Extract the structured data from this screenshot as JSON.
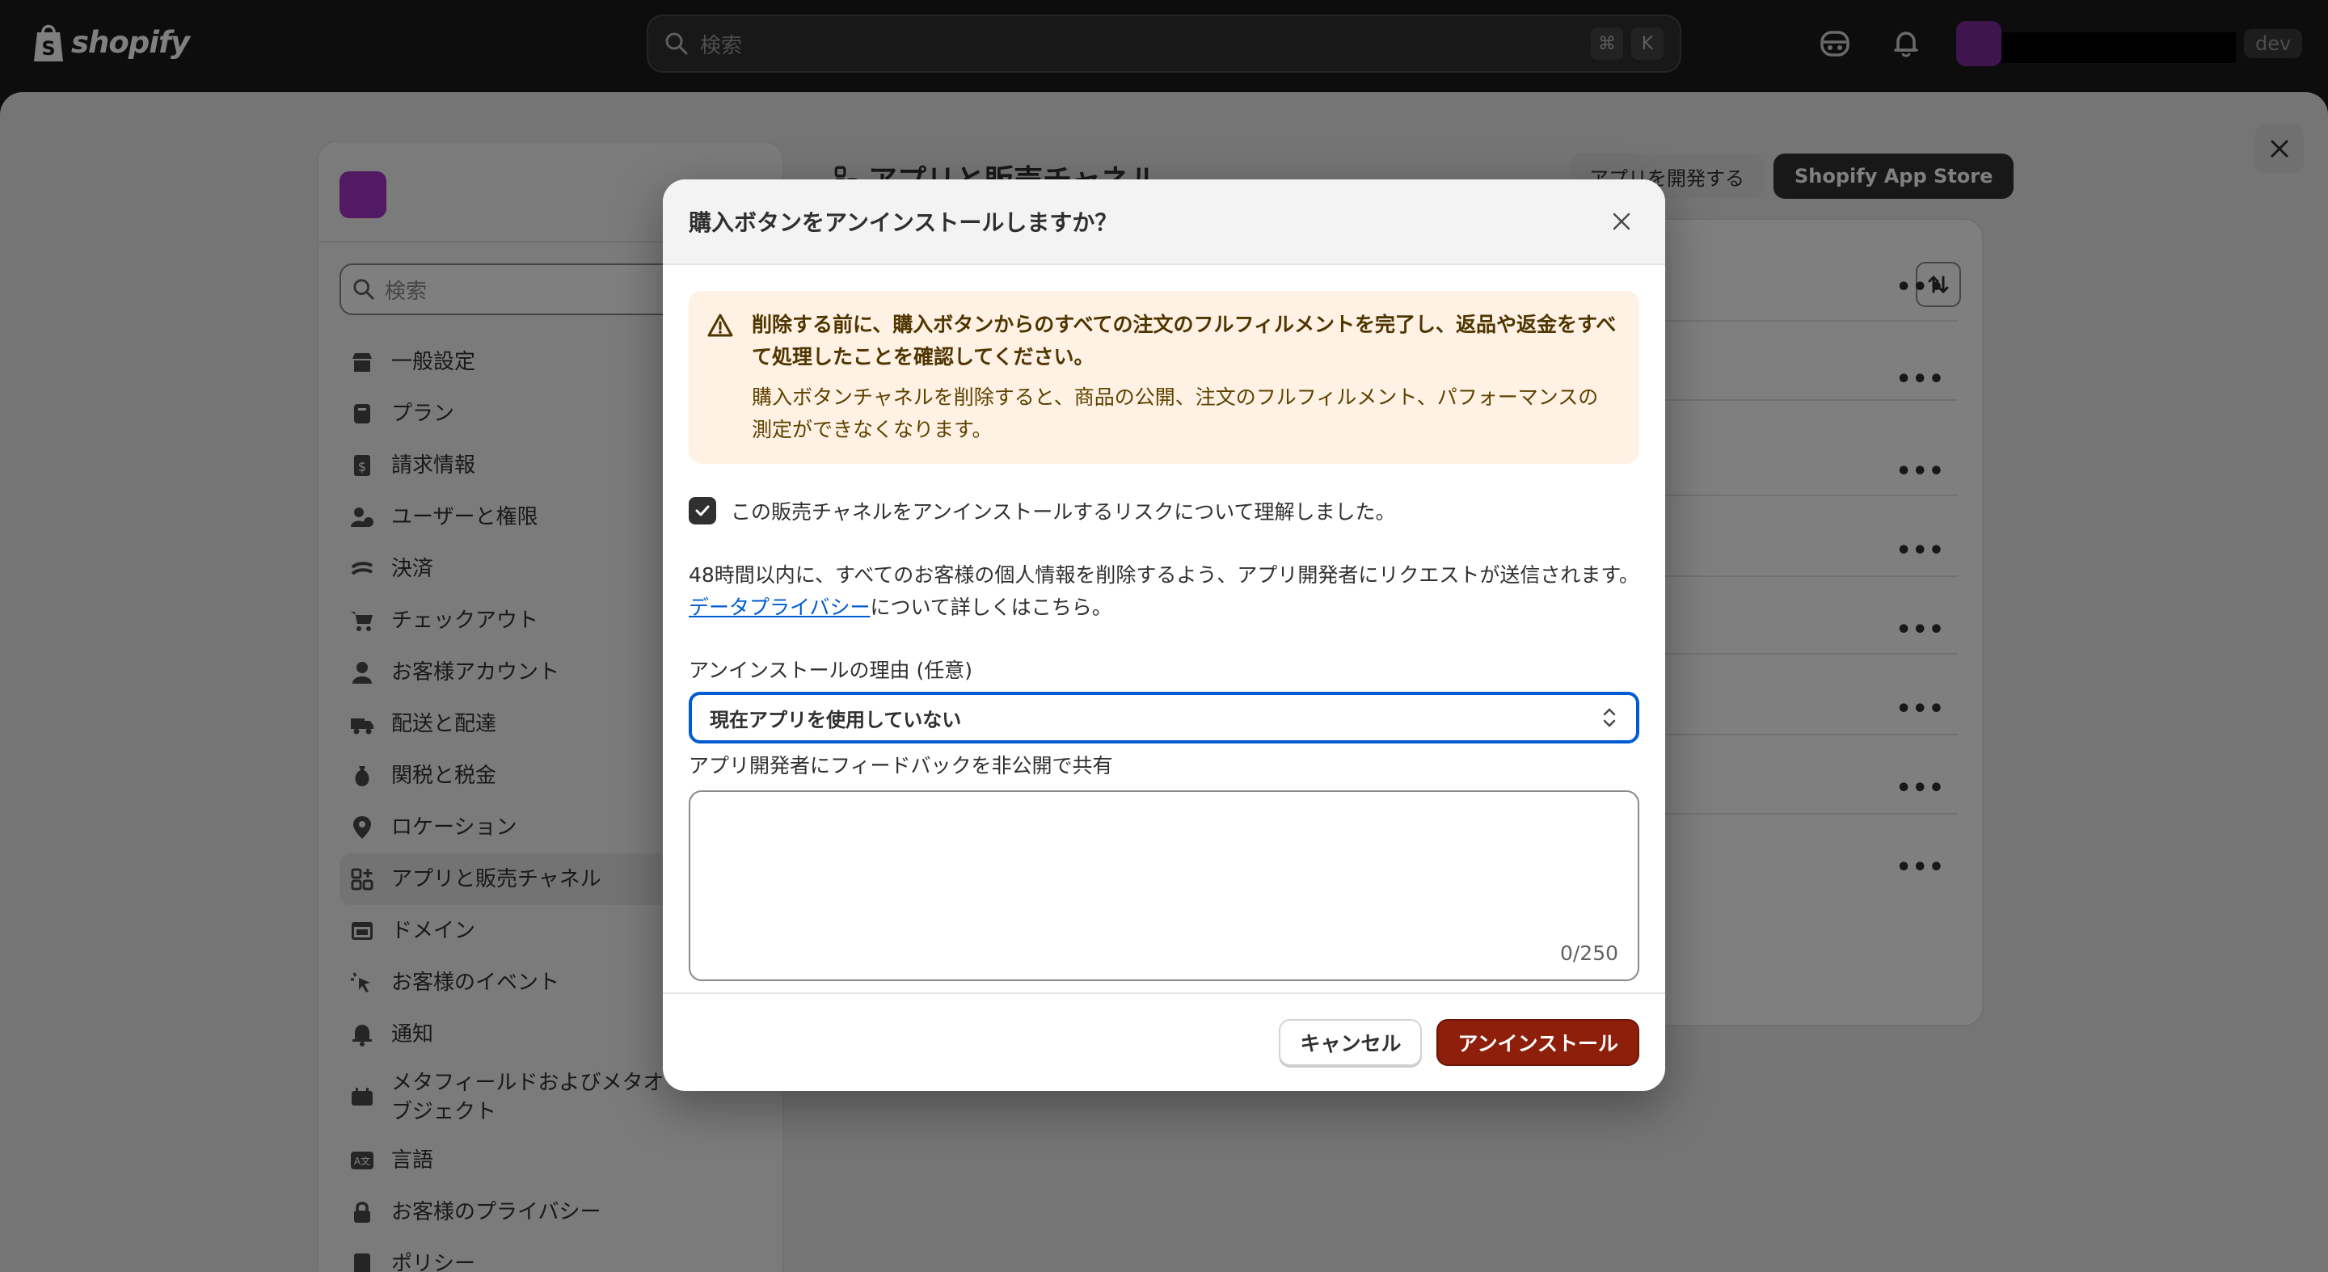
{
  "topbar": {
    "logo_text": "shopify",
    "search_placeholder": "検索",
    "shortcut_keys": [
      "⌘",
      "K"
    ],
    "dev_badge": "dev"
  },
  "settings": {
    "search_placeholder": "検索",
    "sidebar_items": [
      {
        "label": "一般設定",
        "icon": "store-icon"
      },
      {
        "label": "プラン",
        "icon": "plan-icon"
      },
      {
        "label": "請求情報",
        "icon": "billing-icon"
      },
      {
        "label": "ユーザーと権限",
        "icon": "users-icon"
      },
      {
        "label": "決済",
        "icon": "payments-icon"
      },
      {
        "label": "チェックアウト",
        "icon": "cart-icon"
      },
      {
        "label": "お客様アカウント",
        "icon": "person-icon"
      },
      {
        "label": "配送と配達",
        "icon": "truck-icon"
      },
      {
        "label": "関税と税金",
        "icon": "tax-icon"
      },
      {
        "label": "ロケーション",
        "icon": "location-icon"
      },
      {
        "label": "アプリと販売チャネル",
        "icon": "apps-icon"
      },
      {
        "label": "ドメイン",
        "icon": "domain-icon"
      },
      {
        "label": "お客様のイベント",
        "icon": "events-icon"
      },
      {
        "label": "通知",
        "icon": "bell-icon"
      },
      {
        "label": "メタフィールドおよびメタオブジェクト",
        "icon": "metafields-icon"
      },
      {
        "label": "言語",
        "icon": "language-icon"
      },
      {
        "label": "お客様のプライバシー",
        "icon": "lock-icon"
      },
      {
        "label": "ポリシー",
        "icon": "policy-icon"
      }
    ],
    "main_title": "アプリと販売チャネル",
    "btn_develop": "アプリを開発する",
    "btn_store": "Shopify App Store"
  },
  "dialog": {
    "title": "購入ボタンをアンインストールしますか？",
    "banner_title": "削除する前に、購入ボタンからのすべての注文のフルフィルメントを完了し、返品や返金をすべて処理したことを確認してください。",
    "banner_text": "購入ボタンチャネルを削除すると、商品の公開、注文のフルフィルメント、パフォーマンスの測定ができなくなります。",
    "checkbox_label": "この販売チャネルをアンインストールするリスクについて理解しました。",
    "checkbox_checked": true,
    "para_before": "48時間以内に、すべてのお客様の個人情報を削除するよう、アプリ開発者にリクエストが送信されます。",
    "para_link": "データプライバシー",
    "para_after": "について詳しくはこちら。",
    "reason_label": "アンインストールの理由 (任意)",
    "reason_value": "現在アプリを使用していない",
    "feedback_label": "アプリ開発者にフィードバックを非公開で共有",
    "feedback_value": "",
    "counter": "0/250",
    "cancel_label": "キャンセル",
    "uninstall_label": "アンインストール"
  }
}
